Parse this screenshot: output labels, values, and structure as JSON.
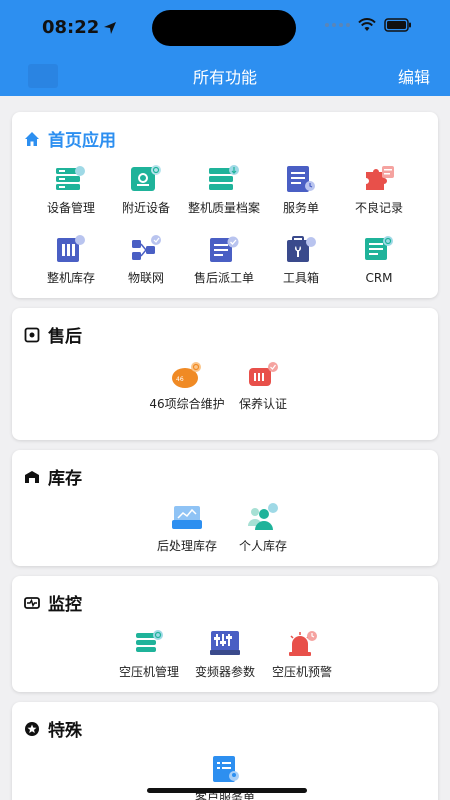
{
  "status": {
    "time": "08:22"
  },
  "header": {
    "title": "所有功能",
    "edit": "编辑"
  },
  "sections": {
    "home": {
      "title": "首页应用",
      "items": [
        "设备管理",
        "附近设备",
        "整机质量档案",
        "服务单",
        "不良记录",
        "整机库存",
        "物联网",
        "售后派工单",
        "工具箱",
        "CRM"
      ]
    },
    "aftersales": {
      "title": "售后",
      "items": [
        "46项综合维护",
        "保养认证"
      ]
    },
    "inventory": {
      "title": "库存",
      "items": [
        "后处理库存",
        "个人库存"
      ]
    },
    "monitor": {
      "title": "监控",
      "items": [
        "空压机管理",
        "变频器参数",
        "空压机预警"
      ]
    },
    "special": {
      "title": "特殊",
      "items": [
        "客户服务单"
      ]
    }
  },
  "colors": {
    "brand": "#2d8ff0",
    "teal": "#1fb39a",
    "red": "#e8504a",
    "orange": "#f08a24",
    "indigo": "#4a5fc4"
  }
}
